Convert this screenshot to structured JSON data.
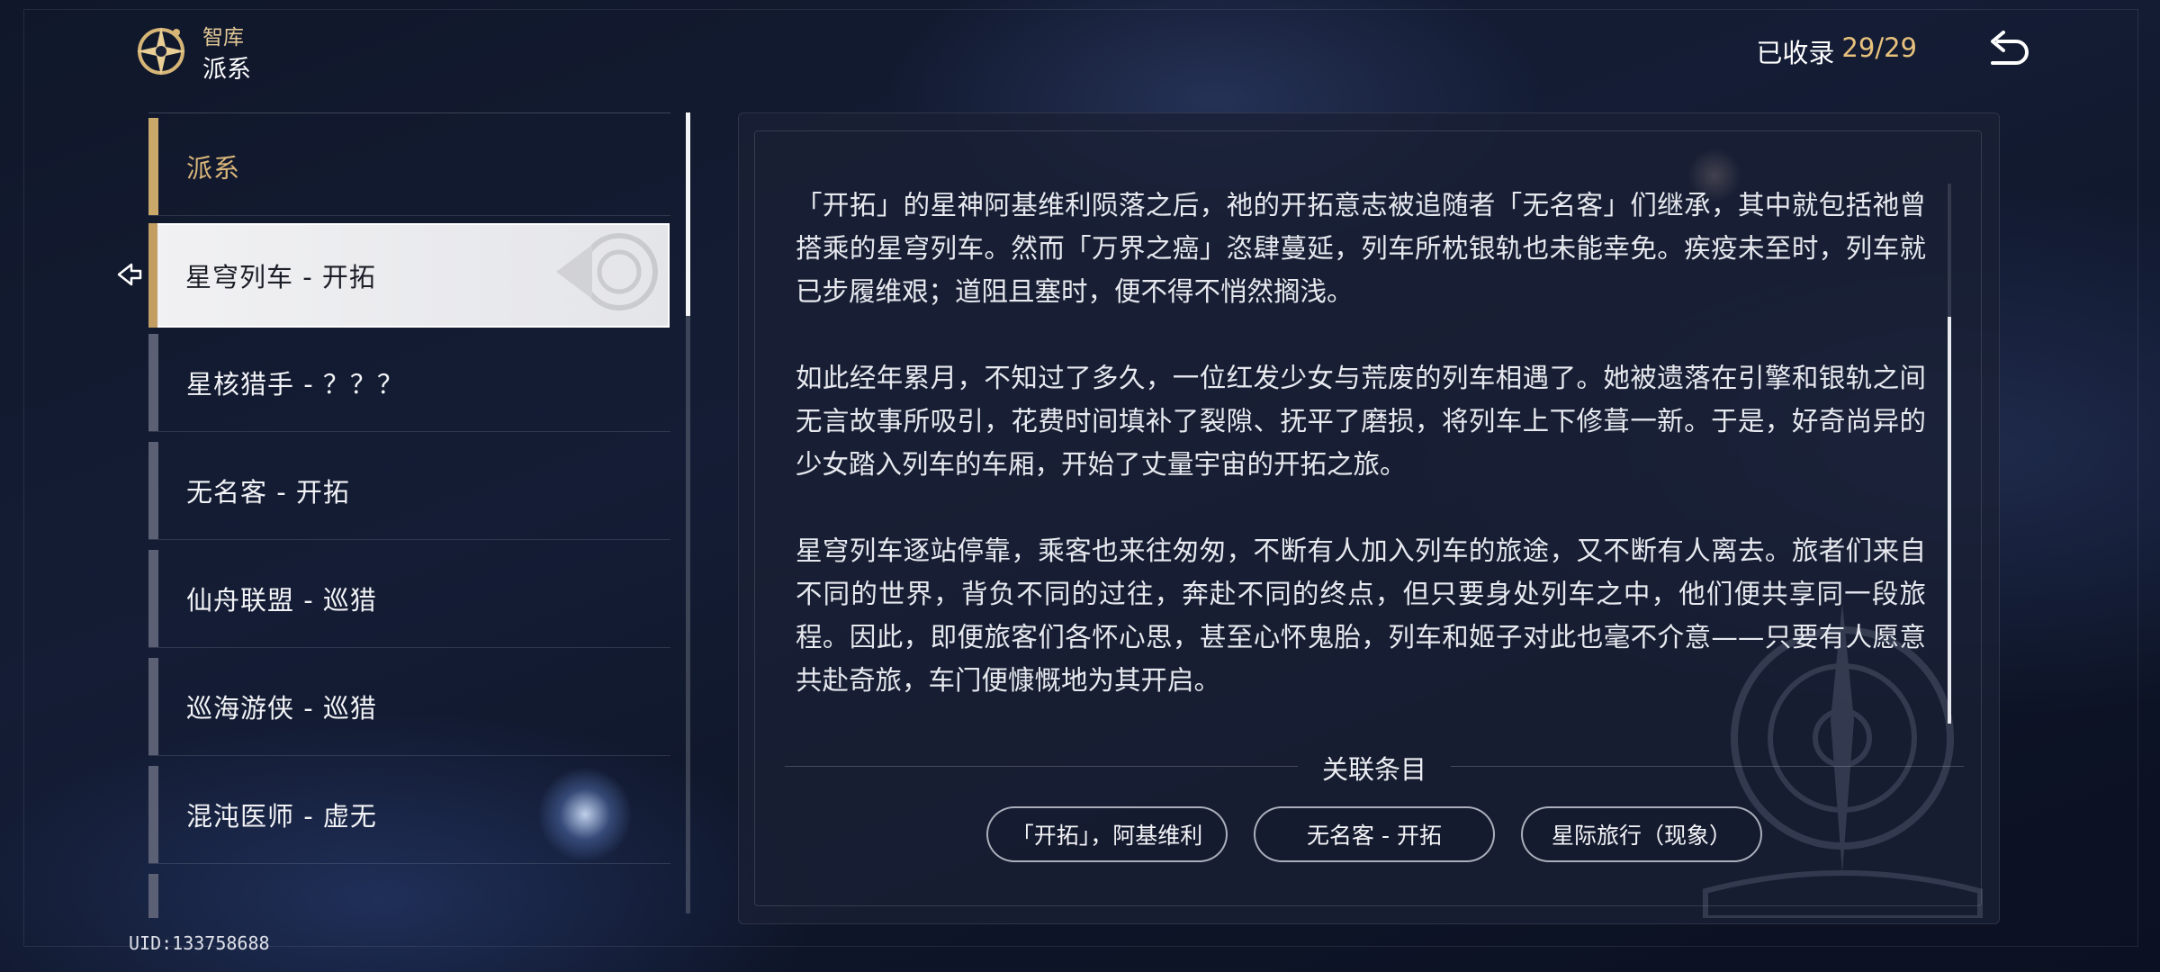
{
  "header": {
    "title": "智库",
    "subtitle": "派系",
    "collected_label": "已收录",
    "collected_count": "29/29",
    "logo_icon": "compass-star-icon",
    "back_icon": "return-arrow-icon"
  },
  "list": {
    "items": [
      {
        "label": "派系",
        "type": "category"
      },
      {
        "label": "星穹列车 - 开拓",
        "type": "entry",
        "selected": true
      },
      {
        "label": "星核猎手 - ？？？",
        "type": "entry"
      },
      {
        "label": "无名客 - 开拓",
        "type": "entry"
      },
      {
        "label": "仙舟联盟 - 巡猎",
        "type": "entry"
      },
      {
        "label": "巡海游侠 - 巡猎",
        "type": "entry"
      },
      {
        "label": "混沌医师 - 虚无",
        "type": "entry"
      },
      {
        "label": "",
        "type": "entry"
      }
    ]
  },
  "content": {
    "paragraphs": [
      "「开拓」的星神阿基维利陨落之后，祂的开拓意志被追随者「无名客」们继承，其中就包括祂曾搭乘的星穹列车。然而「万界之癌」恣肆蔓延，列车所枕银轨也未能幸免。疾疫未至时，列车就已步履维艰；道阻且塞时，便不得不悄然搁浅。",
      "如此经年累月，不知过了多久，一位红发少女与荒废的列车相遇了。她被遗落在引擎和银轨之间无言故事所吸引，花费时间填补了裂隙、抚平了磨损，将列车上下修葺一新。于是，好奇尚异的少女踏入列车的车厢，开始了丈量宇宙的开拓之旅。",
      "星穹列车逐站停靠，乘客也来往匆匆，不断有人加入列车的旅途，又不断有人离去。旅者们来自不同的世界，背负不同的过往，奔赴不同的终点，但只要身处列车之中，他们便共享同一段旅程。因此，即便旅客们各怀心思，甚至心怀鬼胎，列车和姬子对此也毫不介意——只要有人愿意共赴奇旅，车门便慷慨地为其开启。"
    ]
  },
  "related": {
    "title": "关联条目",
    "buttons": [
      "「开拓」，阿基维利",
      "无名客 - 开拓",
      "星际旅行（现象）"
    ]
  },
  "footer": {
    "uid": "UID:133758688"
  },
  "colors": {
    "accent_gold": "#c9a86a",
    "count_gold": "#e8c27d",
    "selected_bg": "#eeeef1"
  }
}
